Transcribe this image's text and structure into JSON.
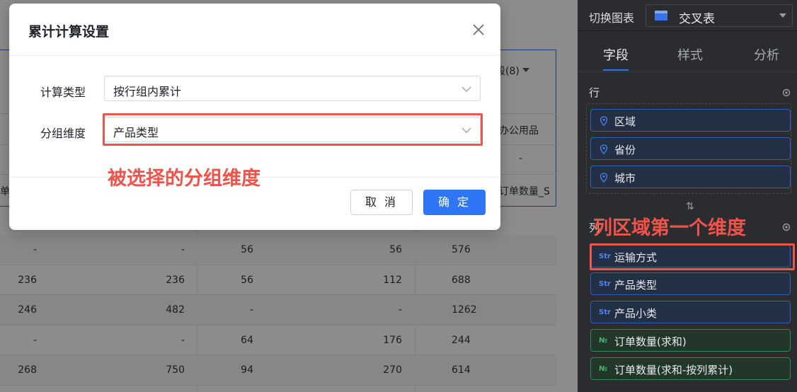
{
  "background_table": {
    "partial_header_right": "段(8)",
    "col_office": "办公用品",
    "dash": "-",
    "col_order_count": "订单数量_S",
    "left_fragment": "订单",
    "rows": [
      [
        "-",
        "-",
        "56",
        "56",
        "576"
      ],
      [
        "236",
        "236",
        "56",
        "112",
        "688"
      ],
      [
        "246",
        "482",
        "-",
        "-",
        "1262"
      ],
      [
        "-",
        "-",
        "64",
        "176",
        "244"
      ],
      [
        "268",
        "750",
        "94",
        "270",
        "614"
      ]
    ]
  },
  "dialog": {
    "title": "累计计算设置",
    "calc_type_label": "计算类型",
    "calc_type_value": "按行组内累计",
    "group_dim_label": "分组维度",
    "group_dim_value": "产品类型",
    "cancel_label": "取 消",
    "ok_label": "确 定"
  },
  "annotations": {
    "selected_group_dim": "被选择的分组维度",
    "first_column_dim": "列区域第一个维度"
  },
  "panel": {
    "switch_chart_label": "切换图表",
    "chart_type": "交叉表",
    "tabs": [
      "字段",
      "样式",
      "分析"
    ],
    "rows_title": "行",
    "row_fields": [
      "区域",
      "省份",
      "城市"
    ],
    "columns_title_fragment": "列",
    "column_fields": [
      {
        "label": "运输方式",
        "kind": "Str"
      },
      {
        "label": "产品类型",
        "kind": "Str"
      },
      {
        "label": "产品小类",
        "kind": "Str"
      },
      {
        "label": "订单数量(求和)",
        "kind": "№"
      },
      {
        "label": "订单数量(求和-按列累计)",
        "kind": "№"
      }
    ],
    "swap_glyph": "⇅"
  },
  "colors": {
    "accent_blue": "#2f76f6",
    "annotation_red": "#f0534a",
    "panel_bg": "#2b2c30",
    "dim_pill_border": "#2f5fbf",
    "measure_pill_border": "#2f8a4f"
  }
}
